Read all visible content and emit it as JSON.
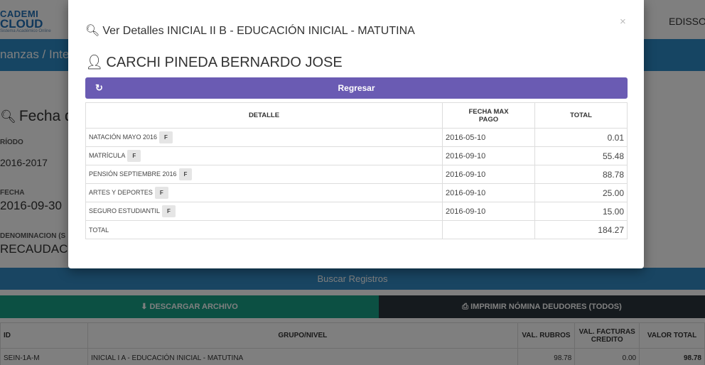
{
  "header": {
    "logo_line1": "CADEMI",
    "logo_line2": "CLOUD",
    "logo_line3": "Sistema Académico Online",
    "user": "EDISSO"
  },
  "breadcrumb": "nanzas / Integ",
  "panel": {
    "title": "Fecha de",
    "periodo_label": "RÍODO",
    "periodo_value": "2016-2017",
    "fecha_label": "FECHA",
    "fecha_value": "2016-09-30",
    "denominacion_label": "DENOMINACION (S",
    "denominacion_value": "RECAUDACI"
  },
  "buttons": {
    "search": "Buscar Registros",
    "download": "DESCARGAR ARCHIVO",
    "print": "IMPRIMIR NÓMINA DEUDORES (TODOS)"
  },
  "bg_table": {
    "headers": [
      "ID",
      "GRUPO/NIVEL",
      "VAL. RUBROS",
      "VAL. FACTURAS CREDITO",
      "VALOR TOTAL"
    ],
    "row": [
      "SEIN-1A-M",
      "INICIAL I A - EDUCACIÓN INICIAL - MATUTINA",
      "98.78",
      "0.00",
      "98.78"
    ]
  },
  "modal": {
    "title": "Ver Detalles INICIAL II B - EDUCACIÓN INICIAL - MATUTINA",
    "student": "CARCHI PINEDA BERNARDO JOSE",
    "back_label": "Regresar",
    "close": "×",
    "table": {
      "headers": {
        "detalle": "DETALLE",
        "fecha_1": "FECHA MAX",
        "fecha_2": "PAGO",
        "total": "TOTAL"
      },
      "rows": [
        {
          "detalle": "NATACIÓN MAYO 2016",
          "badge": "F",
          "fecha": "2016-05-10",
          "total": "0.01"
        },
        {
          "detalle": "MATRÍCULA",
          "badge": "F",
          "fecha": "2016-09-10",
          "total": "55.48"
        },
        {
          "detalle": "PENSIÓN SEPTIEMBRE 2016",
          "badge": "F",
          "fecha": "2016-09-10",
          "total": "88.78"
        },
        {
          "detalle": "ARTES Y DEPORTES",
          "badge": "F",
          "fecha": "2016-09-10",
          "total": "25.00"
        },
        {
          "detalle": "SEGURO ESTUDIANTIL",
          "badge": "F",
          "fecha": "2016-09-10",
          "total": "15.00"
        }
      ],
      "footer": {
        "label": "TOTAL",
        "fecha": "",
        "total": "184.27"
      }
    }
  },
  "colors": {
    "primary_blue": "#2c8ac6",
    "teal": "#18a087",
    "dark": "#2b353d",
    "purple": "#6a5bb3"
  }
}
